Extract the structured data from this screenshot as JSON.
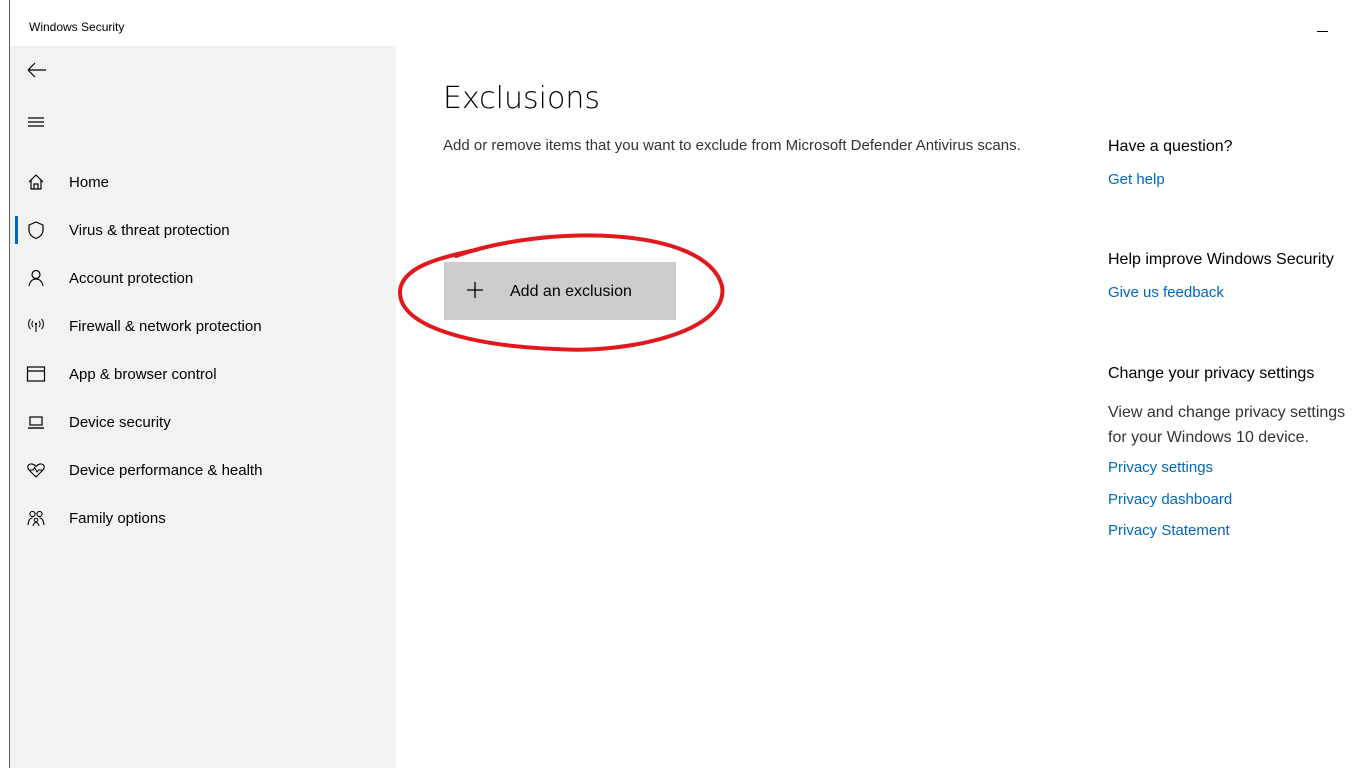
{
  "window": {
    "title": "Windows Security"
  },
  "sidebar": {
    "items": [
      {
        "label": "Home",
        "icon": "home-icon"
      },
      {
        "label": "Virus & threat protection",
        "icon": "shield-icon",
        "active": true
      },
      {
        "label": "Account protection",
        "icon": "person-icon"
      },
      {
        "label": "Firewall & network protection",
        "icon": "antenna-icon"
      },
      {
        "label": "App & browser control",
        "icon": "browser-window-icon"
      },
      {
        "label": "Device security",
        "icon": "laptop-icon"
      },
      {
        "label": "Device performance & health",
        "icon": "heart-pulse-icon"
      },
      {
        "label": "Family options",
        "icon": "family-icon"
      }
    ]
  },
  "main": {
    "title": "Exclusions",
    "description": "Add or remove items that you want to exclude from Microsoft Defender Antivirus scans.",
    "add_button_label": "Add an exclusion"
  },
  "right_panel": {
    "question_heading": "Have a question?",
    "get_help": "Get help",
    "improve_heading": "Help improve Windows Security",
    "feedback": "Give us feedback",
    "privacy_heading": "Change your privacy settings",
    "privacy_text_line1": "View and change privacy settings",
    "privacy_text_line2": "for your Windows 10 device.",
    "privacy_settings": "Privacy settings",
    "privacy_dashboard": "Privacy dashboard",
    "privacy_statement": "Privacy Statement"
  },
  "colors": {
    "accent": "#0067c0",
    "sidebar_bg": "#f2f2f2",
    "button_bg": "#cccccc",
    "annotation": "#e0191f"
  }
}
